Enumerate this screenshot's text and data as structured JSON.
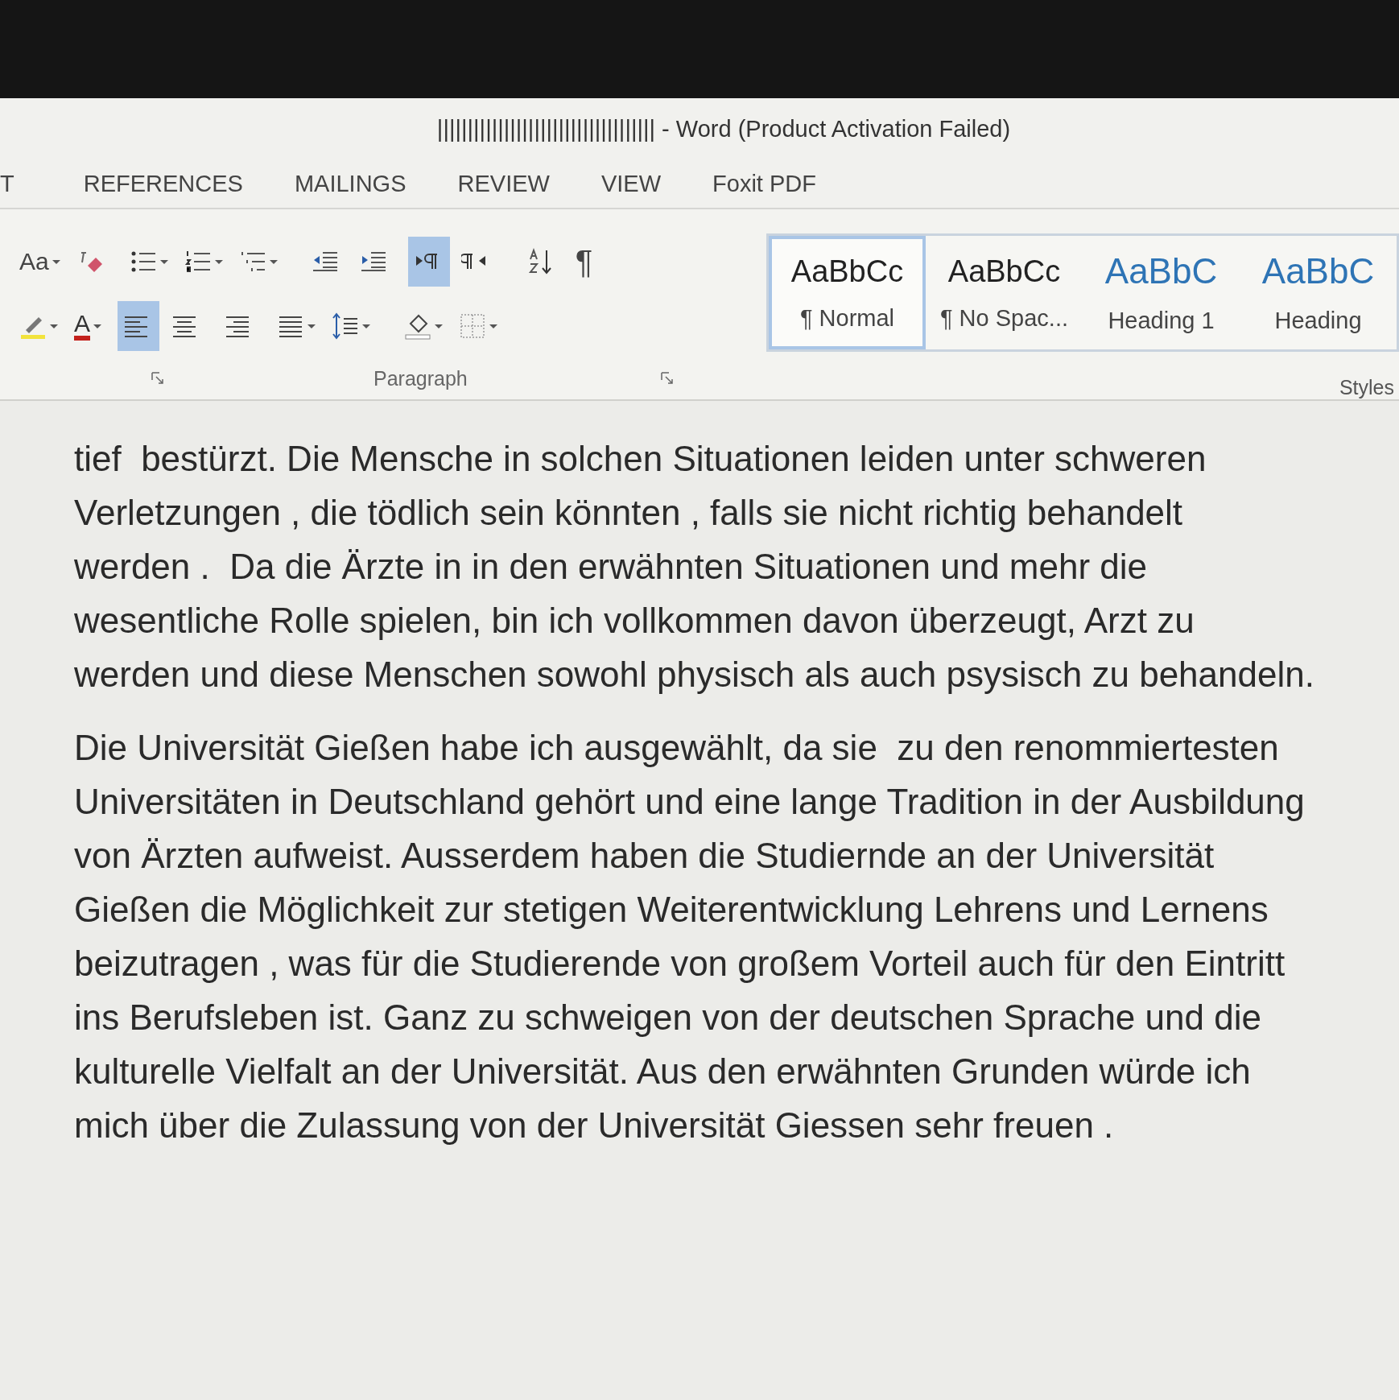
{
  "window": {
    "title": "|||||||||||||||||||||||||||||||||||| - Word (Product Activation Failed)"
  },
  "tabs": [
    {
      "label": "T"
    },
    {
      "label": "REFERENCES"
    },
    {
      "label": "MAILINGS"
    },
    {
      "label": "REVIEW"
    },
    {
      "label": "VIEW"
    },
    {
      "label": "Foxit PDF"
    }
  ],
  "ribbon": {
    "row_1": [
      {
        "kind": "change-case",
        "text": "Aa",
        "on": false,
        "dropdown": true
      },
      {
        "kind": "clear-formatting",
        "on": false,
        "dropdown": false
      },
      {
        "kind": "bullets",
        "on": false,
        "dropdown": true
      },
      {
        "kind": "numbering",
        "on": false,
        "dropdown": true
      },
      {
        "kind": "multilevel",
        "on": false,
        "dropdown": true
      },
      {
        "kind": "decrease-indent",
        "on": false,
        "dropdown": false
      },
      {
        "kind": "increase-indent",
        "on": false,
        "dropdown": false
      },
      {
        "kind": "left-to-right",
        "on": true,
        "dropdown": false
      },
      {
        "kind": "right-to-left",
        "on": false,
        "dropdown": false
      },
      {
        "kind": "sort",
        "on": false,
        "dropdown": false
      },
      {
        "kind": "pilcrow",
        "text": "¶",
        "on": false,
        "dropdown": false
      }
    ],
    "row_2": [
      {
        "kind": "highlight",
        "on": false,
        "dropdown": true
      },
      {
        "kind": "font-color",
        "text": "A",
        "on": false,
        "dropdown": true
      },
      {
        "kind": "align-left",
        "on": true,
        "dropdown": false
      },
      {
        "kind": "align-center",
        "on": false,
        "dropdown": false
      },
      {
        "kind": "align-right",
        "on": false,
        "dropdown": false
      },
      {
        "kind": "justify",
        "on": false,
        "dropdown": true
      },
      {
        "kind": "line-spacing",
        "on": false,
        "dropdown": true
      },
      {
        "kind": "shading",
        "on": false,
        "dropdown": true
      },
      {
        "kind": "borders",
        "on": false,
        "dropdown": true
      }
    ],
    "paragraph_label": "Paragraph",
    "styles_label": "Styles",
    "styles": [
      {
        "preview": "AaBbCc",
        "name": "¶ Normal",
        "kind": "body",
        "selected": true
      },
      {
        "preview": "AaBbCc",
        "name": "¶ No Spac...",
        "kind": "body",
        "selected": false
      },
      {
        "preview": "AaBbC",
        "name": "Heading 1",
        "kind": "heading",
        "selected": false
      },
      {
        "preview": "AaBbC",
        "name": "Heading",
        "kind": "heading",
        "selected": false
      }
    ]
  },
  "document": {
    "paragraphs": [
      {
        "lines": [
          "tief  bestürzt. Die Mensche in solchen Situationen leiden unter schweren",
          "Verletzungen , die tödlich sein könnten , falls sie nicht richtig behandelt",
          "werden .  Da die Ärzte in in den erwähnten Situationen und mehr die",
          "wesentliche Rolle spielen, bin ich vollkommen davon überzeugt, Arzt zu",
          "werden und diese Menschen sowohl physisch als auch psysisch zu behandeln."
        ]
      },
      {
        "lines": [
          "Die Universität Gießen habe ich ausgewählt, da sie  zu den renommiertesten",
          "Universitäten in Deutschland gehört und eine lange Tradition in der Ausbildung",
          "von Ärzten aufweist. Ausserdem haben die Studiernde an der Universität",
          "Gießen die Möglichkeit zur stetigen Weiterentwicklung Lehrens und Lernens",
          "beizutragen , was für die Studierende von großem Vorteil auch für den Eintritt",
          "ins Berufsleben ist. Ganz zu schweigen von der deutschen Sprache und die",
          "kulturelle Vielfalt an der Universität. Aus den erwähnten Grunden würde ich",
          "mich über die Zulassung von der Universität Giessen sehr freuen ."
        ]
      }
    ]
  }
}
